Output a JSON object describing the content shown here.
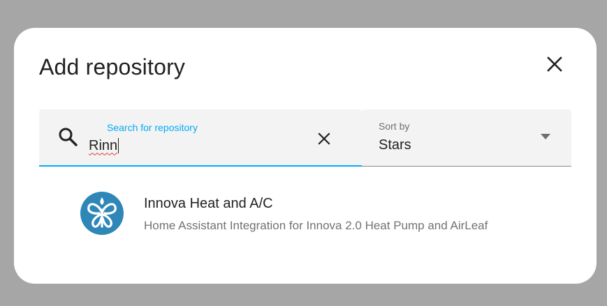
{
  "dialog": {
    "title": "Add repository",
    "close_icon": "close-icon"
  },
  "search": {
    "label": "Search for repository",
    "value": "Rinn",
    "search_icon": "search-icon",
    "clear_icon": "close-icon",
    "accent_color": "#03a9f4"
  },
  "sort": {
    "label": "Sort by",
    "value": "Stars",
    "arrow_icon": "triangle-down-icon"
  },
  "results": [
    {
      "name": "Innova Heat and A/C",
      "description": "Home Assistant Integration for Innova 2.0 Heat Pump and AirLeaf",
      "avatar_icon": "innova-logo-icon",
      "avatar_color": "#2e87b7"
    }
  ]
}
